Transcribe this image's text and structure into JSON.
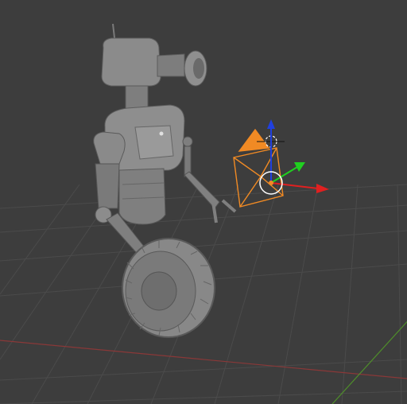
{
  "viewport": {
    "background": "#3d3d3d",
    "grid_color": "#4a4a4a",
    "x_axis_color": "#9a3a3a",
    "y_axis_color": "#5a9a2a"
  },
  "model": {
    "name": "robot",
    "body_color": "#8e8e8e",
    "shadow_color": "#5e5e5e",
    "highlight_color": "#b6b6b6"
  },
  "camera": {
    "wire_color": "#f08a24",
    "cursor_color": "#ffffff"
  },
  "gizmo": {
    "x_color": "#e02020",
    "y_color": "#20d020",
    "z_color": "#2040e0",
    "center_color": "#f08a24"
  }
}
